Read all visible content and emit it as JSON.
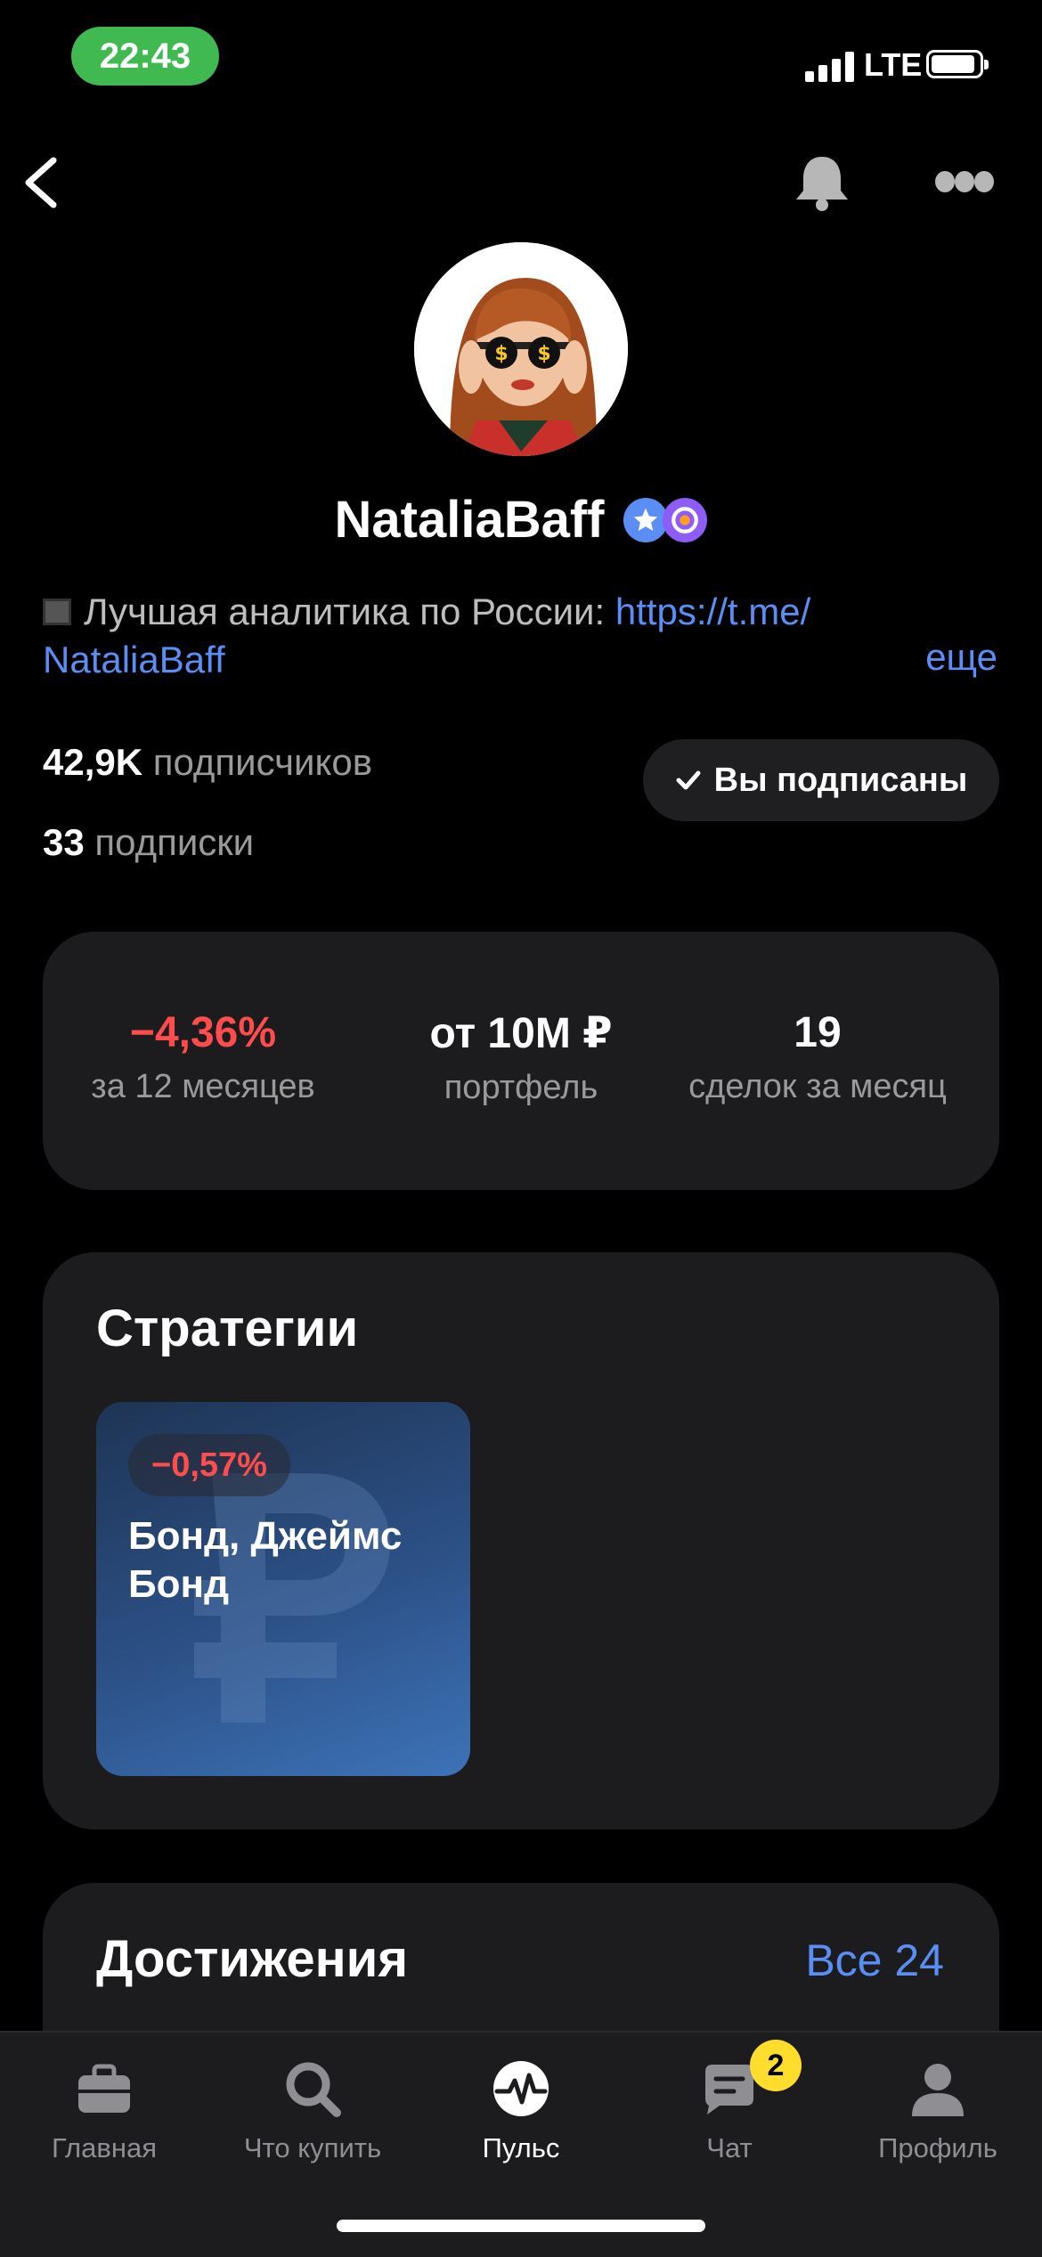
{
  "status_bar": {
    "time": "22:43",
    "network": "LTE"
  },
  "nav": {
    "back_icon": "chevron-left-icon",
    "bell_icon": "bell-icon",
    "more_icon": "more-icon"
  },
  "profile": {
    "username": "NataliaBaff",
    "bio_text": "Лучшая аналитика по России: ",
    "bio_link_1": "https://t.me/",
    "bio_link_2": "NataliaBaff",
    "bio_more": "еще",
    "followers_count": "42,9K",
    "followers_label": " подписчиков",
    "following_count": "33",
    "following_label": " подписки",
    "subscribe_label": "Вы подписаны"
  },
  "stats": [
    {
      "value": "−4,36%",
      "label": "за 12 месяцев",
      "color": "#ff4d4d"
    },
    {
      "value": "от 10М ₽",
      "label": "портфель",
      "color": "#ffffff"
    },
    {
      "value": "19",
      "label": "сделок за месяц",
      "color": "#ffffff"
    }
  ],
  "strategies": {
    "title": "Стратегии",
    "items": [
      {
        "change": "−0,57%",
        "name": "Бонд, Джеймс Бонд"
      }
    ]
  },
  "achievements": {
    "title": "Достижения",
    "all_label": "Все 24"
  },
  "tabbar": {
    "tabs": [
      {
        "label": "Главная",
        "icon": "briefcase-icon"
      },
      {
        "label": "Что купить",
        "icon": "search-icon"
      },
      {
        "label": "Пульс",
        "icon": "pulse-icon"
      },
      {
        "label": "Чат",
        "icon": "chat-icon",
        "badge": "2"
      },
      {
        "label": "Профиль",
        "icon": "profile-icon"
      }
    ]
  },
  "colors": {
    "accent_link": "#5b8ef5",
    "negative": "#ff4d4d",
    "badge_yellow": "#ffdd2d"
  }
}
